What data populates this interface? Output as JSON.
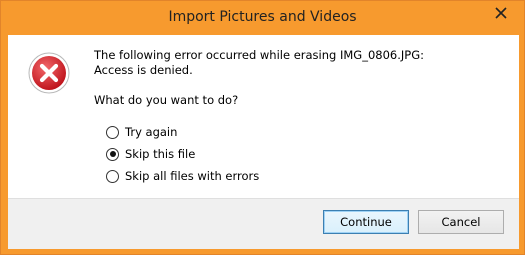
{
  "window": {
    "title": "Import Pictures and Videos"
  },
  "dialog": {
    "icon": "error-icon",
    "message_line1": "The following error occurred while erasing IMG_0806.JPG:",
    "message_line2": "Access is denied.",
    "question": "What do you want to do?",
    "options": [
      {
        "label": "Try again",
        "selected": false
      },
      {
        "label": "Skip this file",
        "selected": true
      },
      {
        "label": "Skip all files with errors",
        "selected": false
      }
    ]
  },
  "buttons": {
    "continue_label": "Continue",
    "cancel_label": "Cancel"
  },
  "colors": {
    "titlebar": "#f79a2e",
    "error_red": "#d9262f"
  }
}
